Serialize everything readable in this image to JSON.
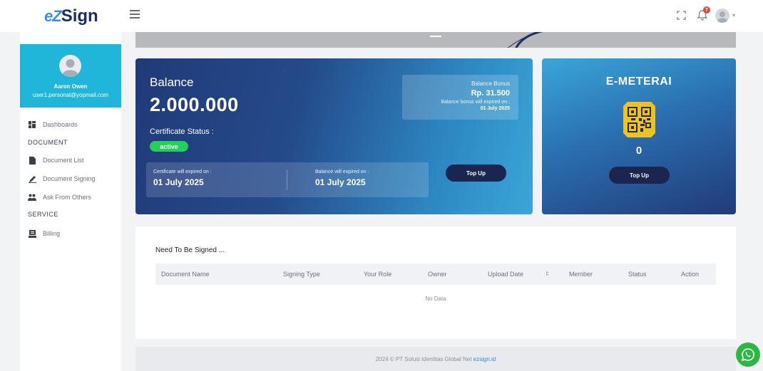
{
  "brand": {
    "logo_mark": "eZ",
    "logo_text": "Sign"
  },
  "topbar": {
    "notification_count": "7"
  },
  "user": {
    "name": "Aaron Owen",
    "email": "user1.personal@yopmail.com"
  },
  "sidebar": {
    "dashboards": "Dashboards",
    "section_document": "DOCUMENT",
    "document_list": "Document List",
    "document_signing": "Document Signing",
    "ask_from_others": "Ask From Others",
    "section_service": "SERVICE",
    "billing": "Billing"
  },
  "balance": {
    "title": "Balance",
    "amount": "2.000.000",
    "certificate_status_label": "Certificate Status :",
    "status": "active",
    "bonus_label": "Balance Bonus",
    "bonus_amount": "Rp. 31.500",
    "bonus_expiry_label": "Balance bonus will expired on :",
    "bonus_expiry_date": "01 July 2025",
    "cert_expiry_label": "Certificate will expired on :",
    "cert_expiry_date": "01 July 2025",
    "balance_expiry_label": "Balance will expired on :",
    "balance_expiry_date": "01 July 2025",
    "topup_label": "Top Up"
  },
  "meterai": {
    "title": "E-METERAI",
    "count": "0",
    "topup_label": "Top Up"
  },
  "signing_table": {
    "title": "Need To Be Signed ...",
    "columns": [
      "Document Name",
      "Signing Type",
      "Your Role",
      "Owner",
      "Upload Date",
      "Member",
      "Status",
      "Action"
    ],
    "empty_text": "No Data"
  },
  "footer": {
    "text": "2024 © PT Solusi Identitas Global Net ",
    "link": "ezsign.id"
  },
  "colors": {
    "accent": "#1fb6d9",
    "brand_dark": "#1e2d5c",
    "status_active": "#24d05a",
    "button_dark": "#1a2550",
    "whatsapp": "#2bb741"
  }
}
